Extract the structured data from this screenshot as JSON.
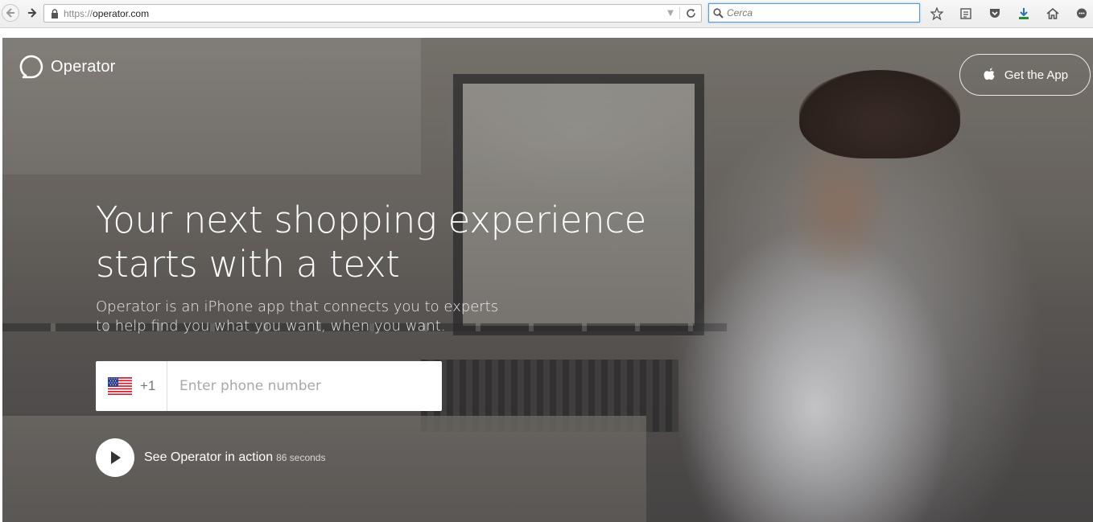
{
  "browser": {
    "url_scheme": "https://",
    "url_host": "operator.com",
    "search_placeholder": "Cerca",
    "toolbar_icons": [
      "bookmark-star-icon",
      "reading-list-icon",
      "pocket-icon",
      "download-icon",
      "home-icon",
      "chat-icon"
    ]
  },
  "page": {
    "logo_text": "Operator",
    "get_app_label": "Get the App",
    "headline_line1": "Your next shopping experience",
    "headline_line2": "starts with a text",
    "subline_line1": "Operator is an iPhone app that connects you to experts",
    "subline_line2": "to help find you what you want, when you want.",
    "phone": {
      "country_icon": "us-flag-icon",
      "dial_code": "+1",
      "placeholder": "Enter phone number",
      "value": ""
    },
    "video": {
      "label": "See Operator in action",
      "duration": "86 seconds"
    }
  },
  "colors": {
    "accent_search_border": "#5b9bd5",
    "download_icon": "#2a8a3a",
    "text_on_hero": "#ffffff"
  }
}
